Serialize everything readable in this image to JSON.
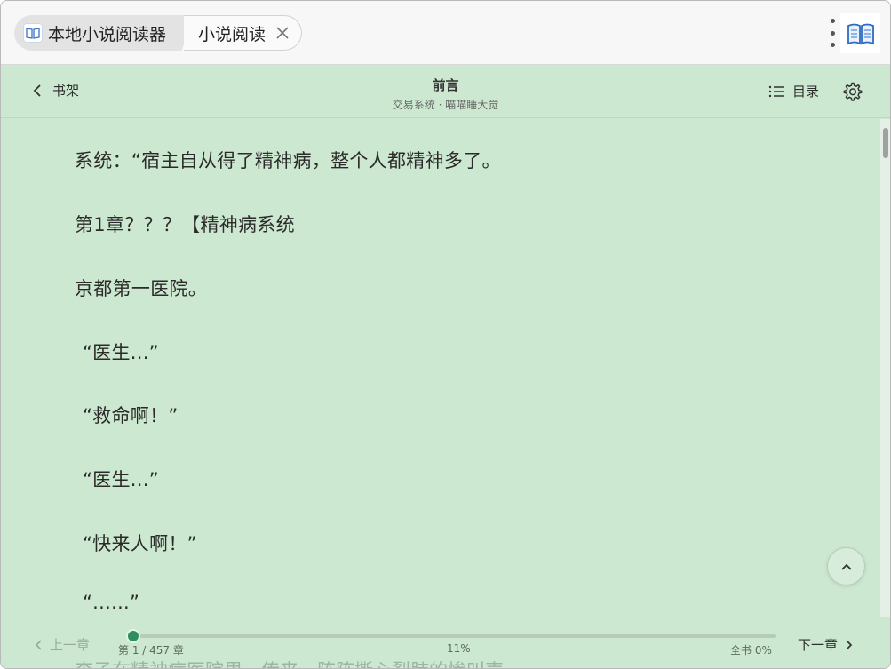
{
  "window": {
    "tabs": [
      {
        "label": "本地小说阅读器",
        "active": true
      },
      {
        "label": "小说阅读",
        "active": false
      }
    ]
  },
  "header": {
    "back_label": "书架",
    "chapter_title": "前言",
    "subtitle": "交易系统 · 喵喵睡大觉",
    "toc_label": "目录"
  },
  "content": {
    "paragraphs": [
      "系统：“宿主自从得了精神病，整个人都精神多了。",
      "第1章？？？【精神病系统",
      "京都第一医院。",
      " “医生...”",
      " “救命啊！”",
      " “医生...”",
      " “快来人啊！”",
      " “......”"
    ]
  },
  "footer": {
    "prev_label": "上一章",
    "next_label": "下一章",
    "chapter_progress": "第 1 / 457 章",
    "percent": "11%",
    "book_progress": "全书 0%",
    "progress_fraction": 0.01,
    "ghost_text": "李子在精神病医院里，传来一阵阵撕心裂肺的惨叫声。"
  },
  "colors": {
    "background": "#cde8d0",
    "accent": "#2f8f5c"
  }
}
